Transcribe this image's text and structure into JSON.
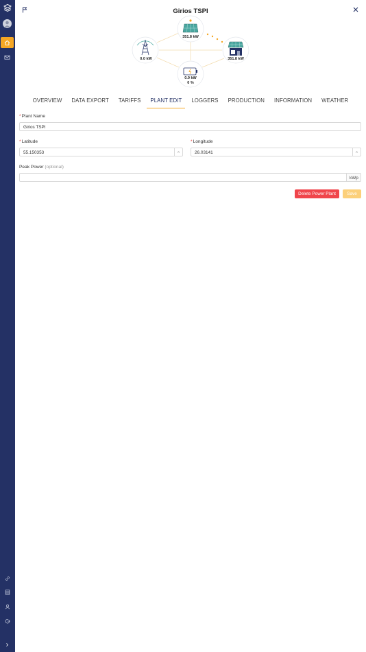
{
  "page": {
    "title": "Girios TSPI"
  },
  "sidebar": {
    "items": [
      {
        "name": "home-icon",
        "active": true
      },
      {
        "name": "mail-icon",
        "active": false
      },
      {
        "name": "link-icon",
        "active": false
      },
      {
        "name": "list-icon",
        "active": false
      },
      {
        "name": "user-icon",
        "active": false
      },
      {
        "name": "logout-icon",
        "active": false
      },
      {
        "name": "chevron-right-icon",
        "active": false
      }
    ]
  },
  "diagram": {
    "solar_label": "351.8 kW",
    "grid_label": "0.0 kW",
    "home_label": "351.8 kW",
    "battery_power_label": "0.0 kW",
    "battery_percent_label": "0 %"
  },
  "tabs": [
    {
      "label": "OVERVIEW",
      "active": false
    },
    {
      "label": "DATA EXPORT",
      "active": false
    },
    {
      "label": "TARIFFS",
      "active": false
    },
    {
      "label": "PLANT EDIT",
      "active": true
    },
    {
      "label": "LOGGERS",
      "active": false
    },
    {
      "label": "PRODUCTION",
      "active": false
    },
    {
      "label": "INFORMATION",
      "active": false
    },
    {
      "label": "WEATHER",
      "active": false
    }
  ],
  "form": {
    "plant_name": {
      "label": "Plant Name",
      "required_mark": "*",
      "value": "Girios TSPI"
    },
    "latitude": {
      "label": "Latitude",
      "required_mark": "*",
      "value": "55.150353"
    },
    "longitude": {
      "label": "Longitude",
      "required_mark": "*",
      "value": "26.03141"
    },
    "peak_power": {
      "label": "Peak Power",
      "optional_text": "(optional)",
      "value": "",
      "unit": "kWp"
    }
  },
  "actions": {
    "delete_label": "Delete Power Plant",
    "save_label": "Save"
  },
  "colors": {
    "sidebar": "#243165",
    "accent": "#f5a623",
    "danger": "#f0454b",
    "save_disabled": "#fcd07a"
  }
}
